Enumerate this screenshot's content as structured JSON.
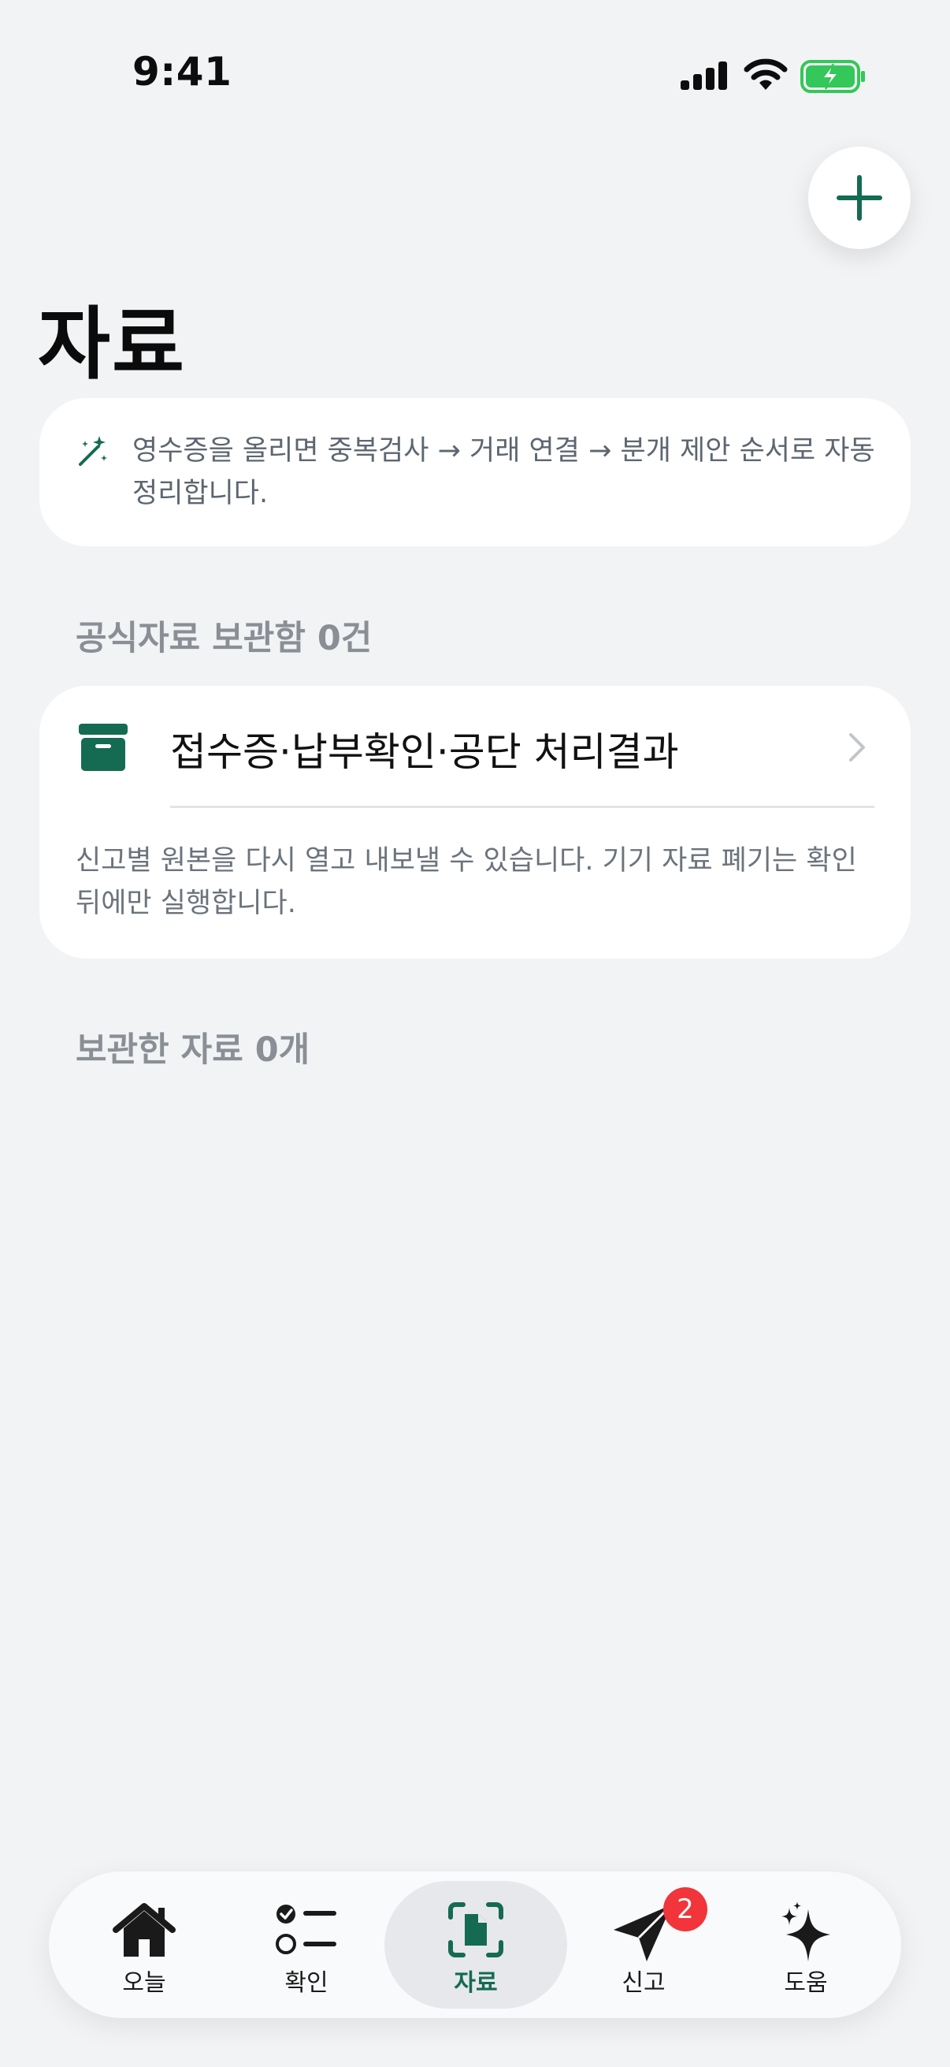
{
  "status_bar": {
    "time": "9:41"
  },
  "page": {
    "title": "자료"
  },
  "tip": {
    "text": "영수증을 올리면 중복검사 → 거래 연결 → 분개 제안 순서로 자동 정리합니다."
  },
  "official": {
    "section_label": "공식자료 보관함 0건",
    "row_label": "접수증·납부확인·공단 처리결과",
    "description": "신고별 원본을 다시 열고 내보낼 수 있습니다. 기기 자료 폐기는 확인 뒤에만 실행합니다."
  },
  "saved": {
    "section_label": "보관한 자료 0개"
  },
  "tabs": [
    {
      "label": "오늘",
      "icon": "house-icon"
    },
    {
      "label": "확인",
      "icon": "checklist-icon"
    },
    {
      "label": "자료",
      "icon": "document-scan-icon",
      "active": true
    },
    {
      "label": "신고",
      "icon": "paper-plane-icon",
      "badge": "2"
    },
    {
      "label": "도움",
      "icon": "sparkles-icon"
    }
  ],
  "colors": {
    "accent": "#146b51",
    "badge": "#f2343b",
    "battery": "#34c759",
    "background": "#f2f3f5"
  }
}
